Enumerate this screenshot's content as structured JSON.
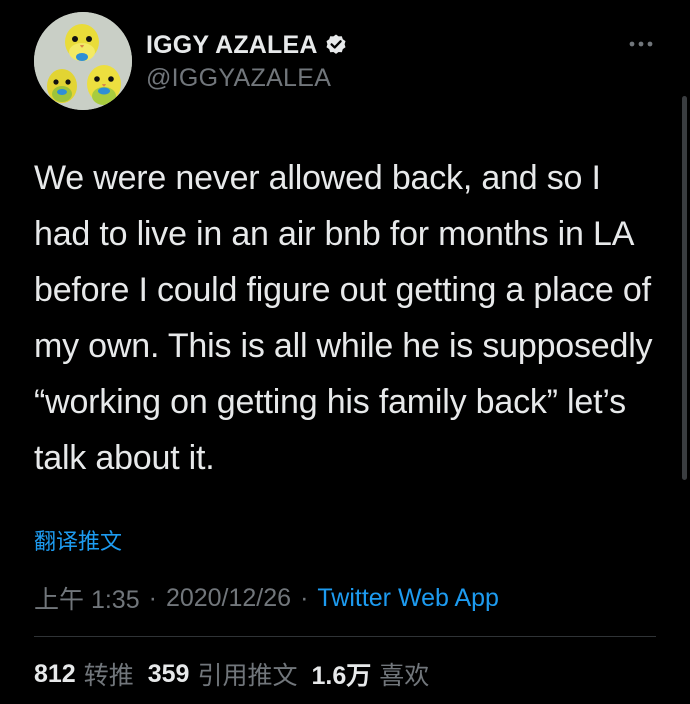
{
  "author": {
    "display_name": "IGGY AZALEA",
    "handle": "@IGGYAZALEA",
    "verified": true,
    "avatar_icon": "avatar-parakeets"
  },
  "tweet": {
    "text": "We were never allowed back, and so I had to live in an air bnb for months in LA before I could figure out getting a place of my own. This is all while he is supposedly “working on getting his family back” let’s talk about it.",
    "translate_label": "翻译推文",
    "time": "上午 1:35",
    "separator": "·",
    "date": "2020/12/26",
    "source": "Twitter Web App"
  },
  "stats": {
    "retweets_count": "812",
    "retweets_label": "转推",
    "quotes_count": "359",
    "quotes_label": "引用推文",
    "likes_count": "1.6万",
    "likes_label": "喜欢"
  },
  "colors": {
    "background": "#000000",
    "primary_text": "#e7e9ea",
    "secondary_text": "#71767b",
    "link": "#1d9bf0",
    "divider": "#2f3336"
  }
}
